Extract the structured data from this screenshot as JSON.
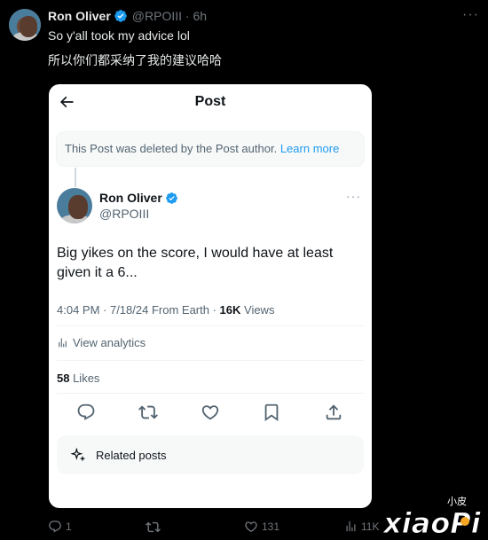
{
  "outer_tweet": {
    "name": "Ron Oliver",
    "handle_time": "@RPOIII · 6h",
    "text_line1": "So y'all took my advice lol",
    "text_line2": "所以你们都采纳了我的建议哈哈",
    "more": "···"
  },
  "card": {
    "title": "Post",
    "deleted_text": "This Post was deleted by the Post author.",
    "deleted_link": "Learn more",
    "author_name": "Ron Oliver",
    "author_handle": "@RPOIII",
    "more": "···",
    "body": "Big yikes on the score, I would have at least given it a 6...",
    "meta_time": "4:04 PM · 7/18/24 From Earth · ",
    "meta_views_count": "16K",
    "meta_views_label": " Views",
    "analytics_label": "View analytics",
    "likes_count": "58",
    "likes_label": " Likes",
    "related_label": "Related posts"
  },
  "outer_actions": {
    "replies": "1",
    "retweets": "",
    "likes": "131",
    "views": "11K"
  },
  "watermark": {
    "small": "小皮",
    "big": "xiaoPi"
  },
  "colors": {
    "accent": "#1d9bf0",
    "background": "#000000",
    "card_bg": "#ffffff",
    "muted": "#71767b"
  }
}
